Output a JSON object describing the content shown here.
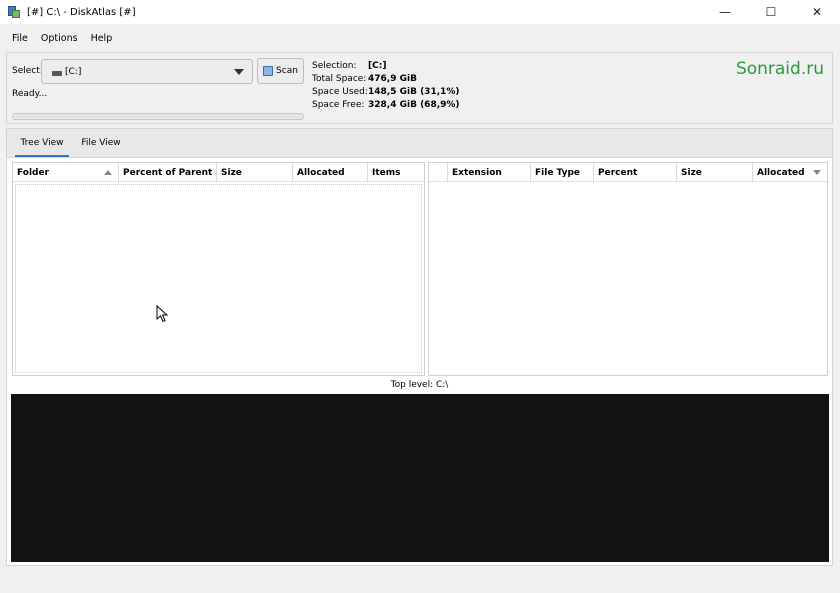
{
  "window": {
    "title": "[#] C:\\ - DiskAtlas [#]",
    "controls": {
      "minimize": "—",
      "maximize": "☐",
      "close": "✕"
    }
  },
  "menu": [
    "File",
    "Options",
    "Help"
  ],
  "toolbar": {
    "select_label": "Select:",
    "drive": "[C:]",
    "scan_label": "Scan",
    "status": "Ready...",
    "progress": 0
  },
  "info": {
    "selection_label": "Selection:",
    "selection_value": "[C:]",
    "total_label": "Total Space:",
    "total_value": "476,9 GiB",
    "used_label": "Space Used:",
    "used_value": "148,5 GiB (31,1%)",
    "free_label": "Space Free:",
    "free_value": "328,4 GiB (68,9%)"
  },
  "watermark": "Sonraid.ru",
  "tabs": [
    {
      "label": "Tree View",
      "active": true
    },
    {
      "label": "File View",
      "active": false
    }
  ],
  "tree_columns": [
    "Folder",
    "Percent of Parent",
    "Size",
    "Allocated",
    "Items"
  ],
  "ext_columns": [
    "",
    "Extension",
    "File Type",
    "Percent",
    "Size",
    "Allocated"
  ],
  "toplevel": "Top level: C:\\",
  "colors": {
    "accent": "#2b78d4",
    "watermark": "#2a9a3c",
    "treemap_bg": "#111214"
  }
}
